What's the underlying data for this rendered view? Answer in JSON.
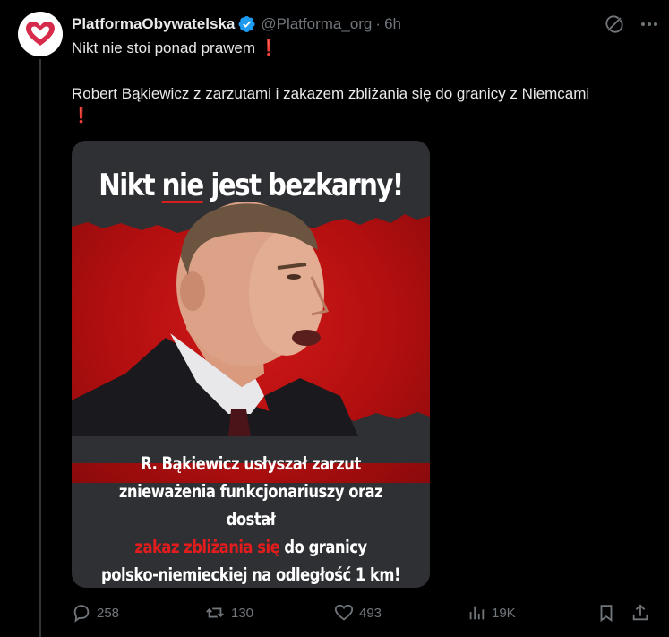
{
  "post": {
    "display_name": "PlatformaObywatelska",
    "handle": "@Platforma_org",
    "separator": "·",
    "time": "6h",
    "text_line1": "Nikt nie stoi ponad prawem",
    "text_line2": "Robert Bąkiewicz z zarzutami i zakazem zbliżania się do granicy z Niemcami",
    "emoji": "❗"
  },
  "media": {
    "title_part1": "Nikt ",
    "title_part2": "nie",
    "title_part3": " jest bezkarny!",
    "caption_line1": "R. Bąkiewicz usłyszał zarzut",
    "caption_line2": "znieważenia funkcjonariuszy oraz dostał",
    "caption_red": "zakaz zbliżania się",
    "caption_line3_rest": " do granicy",
    "caption_line4": "polsko-niemieckiej  na odległość 1 km!",
    "accent_red": "#d01818"
  },
  "actions": {
    "replies": "258",
    "reposts": "130",
    "likes": "493",
    "views": "19K"
  },
  "colors": {
    "background": "#000000",
    "text": "#e7e9ea",
    "muted": "#71767b",
    "verified": "#1d9bf0",
    "avatar_heart": "#d62b4b"
  }
}
